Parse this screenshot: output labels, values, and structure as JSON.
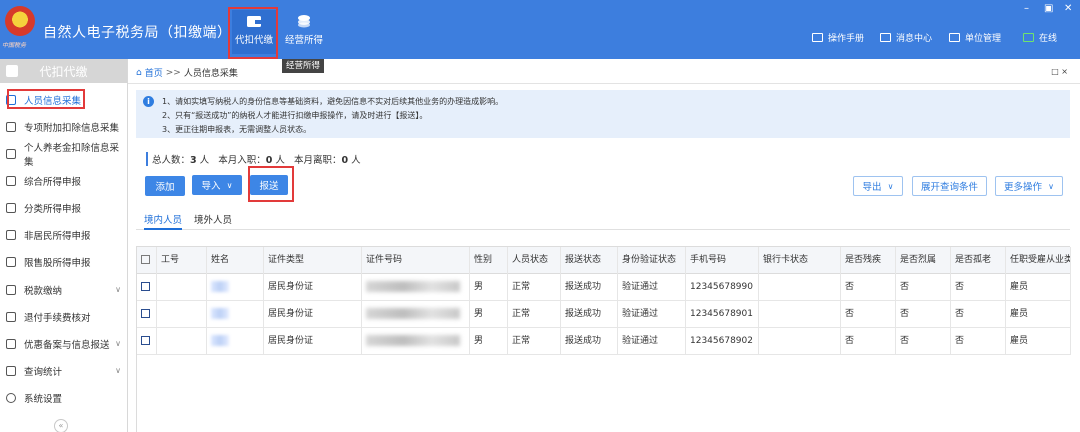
{
  "app": {
    "title": "自然人电子税务局（扣缴端）",
    "emblem_text": "中国税务"
  },
  "topnav": {
    "tiles": [
      {
        "label": "代扣代缴",
        "icon": "wallet-icon"
      },
      {
        "label": "经营所得",
        "icon": "coins-icon"
      }
    ],
    "tooltip": "经营所得",
    "links": [
      {
        "label": "操作手册",
        "icon": "manual-icon"
      },
      {
        "label": "消息中心",
        "icon": "mail-icon"
      },
      {
        "label": "单位管理",
        "icon": "building-icon"
      },
      {
        "label": "在线",
        "icon": "monitor-icon",
        "color": "#6ee36e"
      }
    ]
  },
  "sidebar": {
    "header": "代扣代缴",
    "items": [
      {
        "label": "人员信息采集",
        "icon": "person-icon",
        "active": true
      },
      {
        "label": "专项附加扣除信息采集",
        "icon": "list-icon"
      },
      {
        "label": "个人养老金扣除信息采集",
        "icon": "id-card-icon"
      },
      {
        "label": "综合所得申报",
        "icon": "layers-icon"
      },
      {
        "label": "分类所得申报",
        "icon": "pie-icon"
      },
      {
        "label": "非居民所得申报",
        "icon": "user-foreign-icon"
      },
      {
        "label": "限售股所得申报",
        "icon": "chart-icon"
      },
      {
        "label": "税款缴纳",
        "icon": "tax-icon",
        "expandable": true
      },
      {
        "label": "退付手续费核对",
        "icon": "check-doc-icon"
      },
      {
        "label": "优惠备案与信息报送",
        "icon": "gift-icon",
        "expandable": true
      },
      {
        "label": "查询统计",
        "icon": "search-list-icon",
        "expandable": true
      },
      {
        "label": "系统设置",
        "icon": "gear-icon"
      }
    ],
    "collapse_glyph": "«"
  },
  "breadcrumb": {
    "home": "首页",
    "separator": ">>",
    "current": "人员信息采集",
    "controls": "□ ×"
  },
  "notice": {
    "lines": [
      "1、请如实填写纳税人的身份信息等基础资料，避免因信息不实对后续其他业务的办理造成影响。",
      "2、只有“报送成功”的纳税人才能进行扣缴申报操作，请及时进行【报送】。",
      "3、更正往期申报表，无需调整人员状态。"
    ]
  },
  "stats": {
    "total_label": "总人数：",
    "total": "3",
    "total_unit": "人",
    "hired_label": "本月入职：",
    "hired": "0",
    "hired_unit": "人",
    "left_label": "本月离职：",
    "left": "0",
    "left_unit": "人"
  },
  "toolbar": {
    "add": "添加",
    "import": "导入",
    "submit": "报送",
    "export": "导出",
    "expand_query": "展开查询条件",
    "more": "更多操作",
    "chevron": "∨"
  },
  "tabs": [
    {
      "label": "境内人员",
      "active": true
    },
    {
      "label": "境外人员"
    }
  ],
  "table": {
    "columns": [
      "工号",
      "姓名",
      "证件类型",
      "证件号码",
      "性别",
      "人员状态",
      "报送状态",
      "身份验证状态",
      "手机号码",
      "银行卡状态",
      "是否残疾",
      "是否烈属",
      "是否孤老",
      "任职受雇从业类"
    ],
    "rows": [
      {
        "id_type": "居民身份证",
        "gender": "男",
        "status": "正常",
        "submit_status": "报送成功",
        "verify_status": "验证通过",
        "phone": "12345678990",
        "bank": "",
        "disabled": "否",
        "martyr": "否",
        "elderly": "否",
        "employment": "雇员"
      },
      {
        "id_type": "居民身份证",
        "gender": "男",
        "status": "正常",
        "submit_status": "报送成功",
        "verify_status": "验证通过",
        "phone": "12345678901",
        "bank": "",
        "disabled": "否",
        "martyr": "否",
        "elderly": "否",
        "employment": "雇员"
      },
      {
        "id_type": "居民身份证",
        "gender": "男",
        "status": "正常",
        "submit_status": "报送成功",
        "verify_status": "验证通过",
        "phone": "12345678902",
        "bank": "",
        "disabled": "否",
        "martyr": "否",
        "elderly": "否",
        "employment": "雇员"
      }
    ]
  },
  "colors": {
    "topbar": "#3d7ede",
    "accent": "#1f6fd8",
    "highlight_box": "#e23a3a",
    "online": "#6ee36e"
  }
}
